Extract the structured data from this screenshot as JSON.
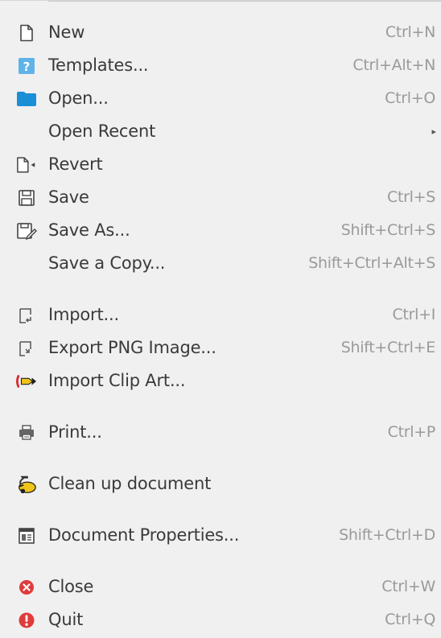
{
  "menu": {
    "items": [
      {
        "label": "New",
        "accel": "Ctrl+N",
        "icon": "new-document-icon"
      },
      {
        "label": "Templates...",
        "accel": "Ctrl+Alt+N",
        "icon": "templates-icon"
      },
      {
        "label": "Open...",
        "accel": "Ctrl+O",
        "icon": "folder-icon"
      },
      {
        "label": "Open Recent",
        "accel": "",
        "icon": "",
        "submenu_arrow": "▸"
      },
      {
        "label": "Revert",
        "accel": "",
        "icon": "revert-icon"
      },
      {
        "label": "Save",
        "accel": "Ctrl+S",
        "icon": "save-icon"
      },
      {
        "label": "Save As...",
        "accel": "Shift+Ctrl+S",
        "icon": "save-as-icon"
      },
      {
        "label": "Save a Copy...",
        "accel": "Shift+Ctrl+Alt+S",
        "icon": ""
      },
      {
        "label": "Import...",
        "accel": "Ctrl+I",
        "icon": "import-icon"
      },
      {
        "label": "Export PNG Image...",
        "accel": "Shift+Ctrl+E",
        "icon": "export-icon"
      },
      {
        "label": "Import Clip Art...",
        "accel": "",
        "icon": "import-clip-art-icon"
      },
      {
        "label": "Print...",
        "accel": "Ctrl+P",
        "icon": "printer-icon"
      },
      {
        "label": "Clean up document",
        "accel": "",
        "icon": "vacuum-cleaner-icon"
      },
      {
        "label": "Document Properties...",
        "accel": "Shift+Ctrl+D",
        "icon": "document-properties-icon"
      },
      {
        "label": "Close",
        "accel": "Ctrl+W",
        "icon": "close-icon"
      },
      {
        "label": "Quit",
        "accel": "Ctrl+Q",
        "icon": "quit-icon"
      }
    ]
  },
  "colors": {
    "menu_background": "#f0f0f0",
    "label_text": "#3a3a3a",
    "accel_text": "#9a9a9a",
    "folder_blue": "#1a8fd6",
    "templates_blue": "#5fb3e8",
    "close_red": "#e03b3b",
    "clip_art_yellow": "#f0c419"
  }
}
